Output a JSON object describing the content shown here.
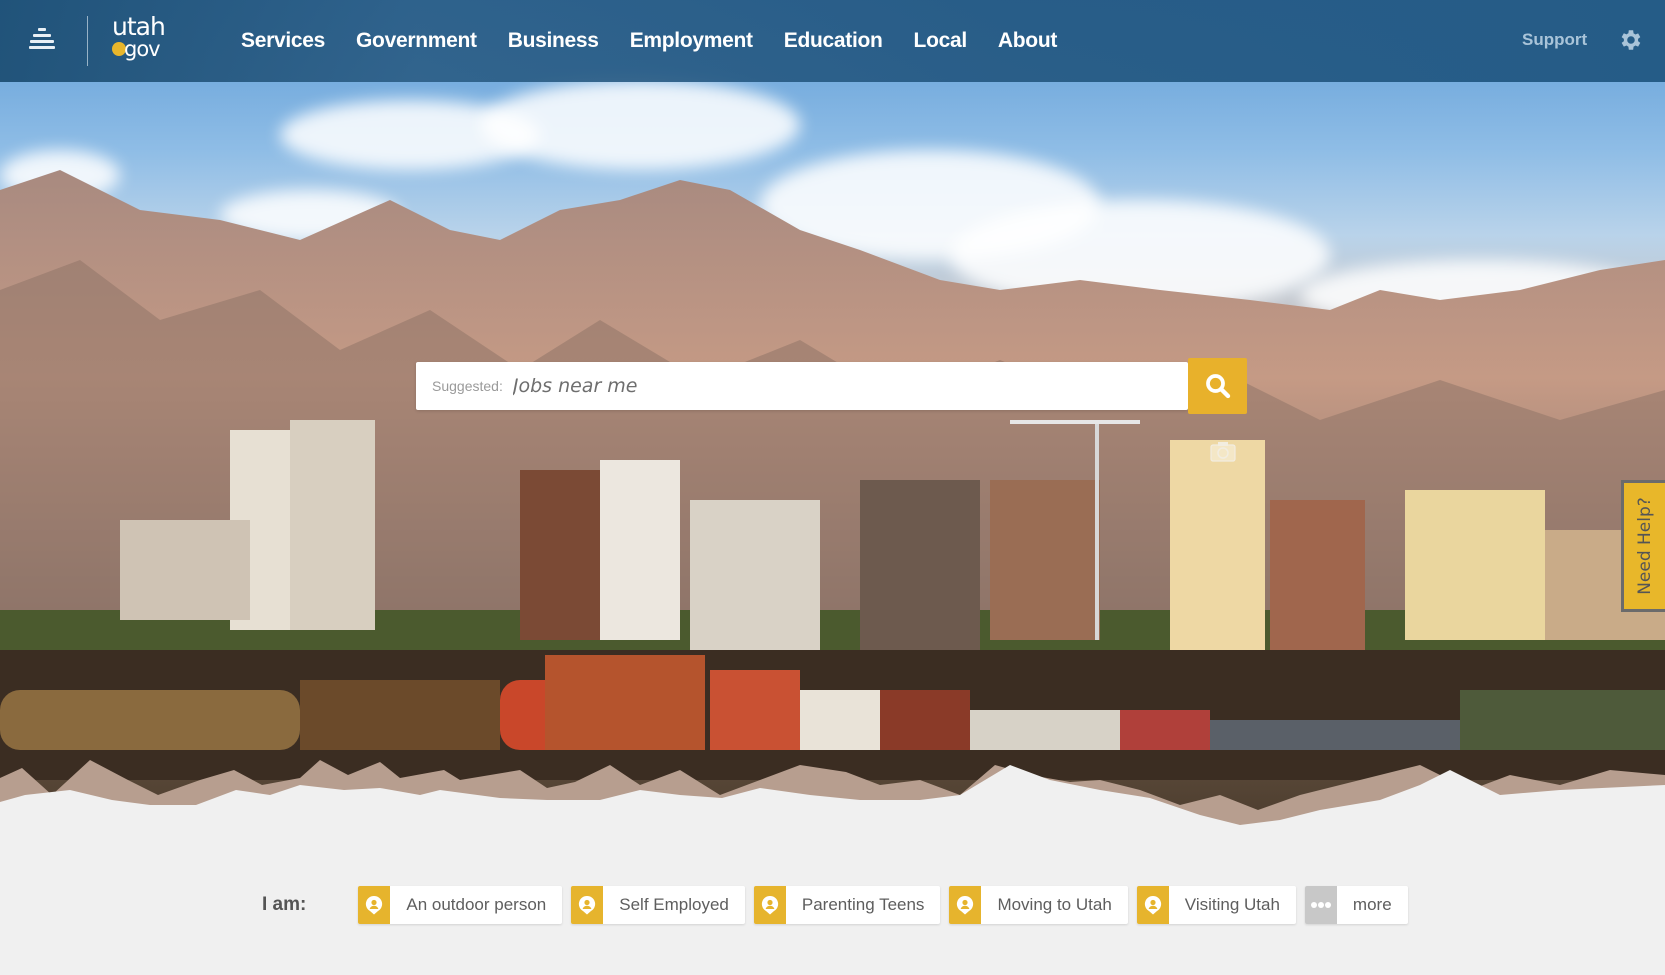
{
  "header": {
    "menu_icon": "utah-gov-menu-icon",
    "logo": {
      "line1": "utah",
      "line2": "gov",
      "accent_color": "#e8b62c"
    },
    "nav": [
      {
        "label": "Services"
      },
      {
        "label": "Government"
      },
      {
        "label": "Business"
      },
      {
        "label": "Employment"
      },
      {
        "label": "Education"
      },
      {
        "label": "Local"
      },
      {
        "label": "About"
      }
    ],
    "support_label": "Support",
    "settings_icon": "gear-icon",
    "background_color": "#255c87"
  },
  "search": {
    "suggested_label": "Suggested:",
    "placeholder": "Jobs near me",
    "value": "",
    "button_icon": "search-icon",
    "button_color": "#e8b12b"
  },
  "hero": {
    "description": "Salt Lake City skyline with Wasatch mountains and freight train",
    "photo_credit_icon": "camera-icon"
  },
  "need_help": {
    "label": "Need Help?",
    "color": "#e8b72a"
  },
  "i_am": {
    "label": "I am:",
    "options": [
      {
        "label": "An outdoor person",
        "icon": "person-pin-icon"
      },
      {
        "label": "Self Employed",
        "icon": "person-pin-icon"
      },
      {
        "label": "Parenting Teens",
        "icon": "person-pin-icon"
      },
      {
        "label": "Moving to Utah",
        "icon": "person-pin-icon"
      },
      {
        "label": "Visiting Utah",
        "icon": "person-pin-icon"
      },
      {
        "label": "more",
        "icon": "ellipsis-icon"
      }
    ]
  }
}
